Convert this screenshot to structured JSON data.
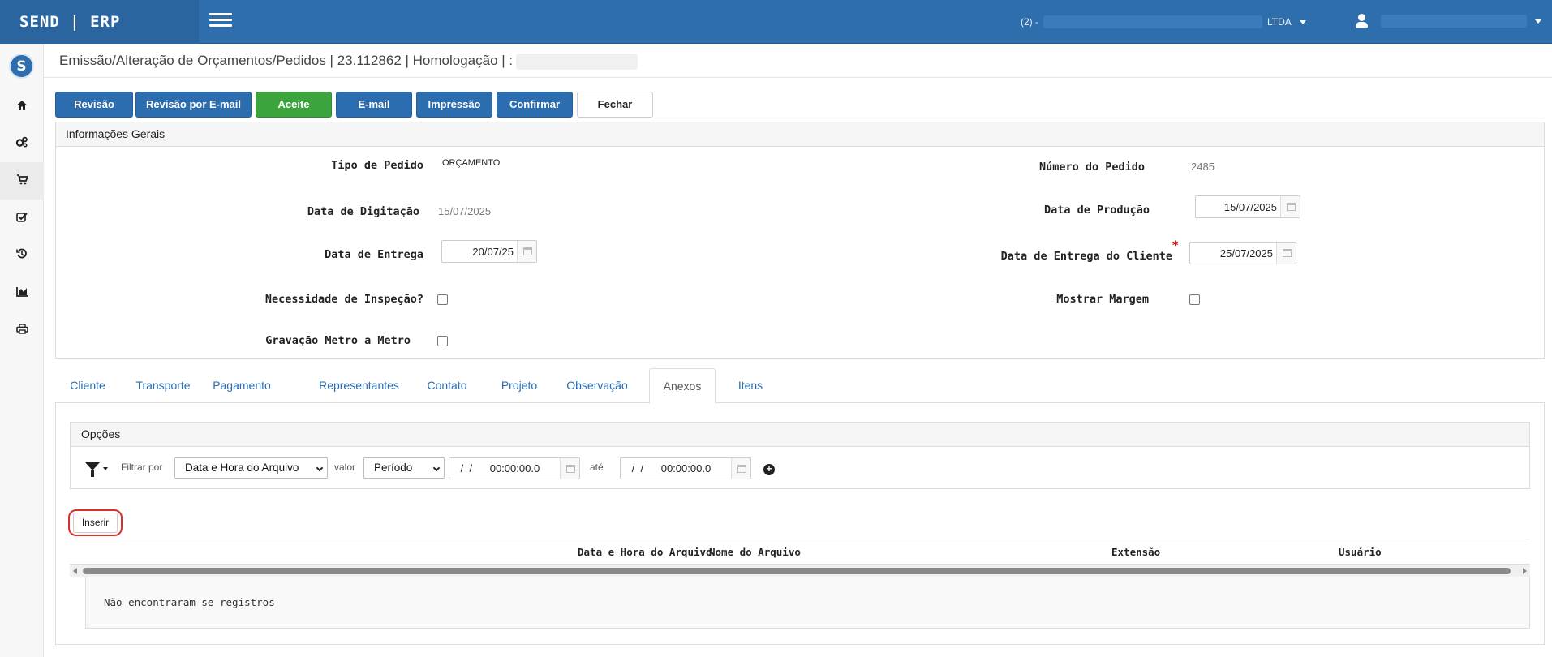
{
  "app": {
    "brand": "SEND | ERP"
  },
  "header": {
    "company_prefix": "(2) -",
    "company_suffix": "LTDA"
  },
  "breadcrumb": {
    "text": "Emissão/Alteração de Orçamentos/Pedidos | 23.112862 | Homologação | :"
  },
  "toolbar": {
    "revisao": "Revisão",
    "revisao_email": "Revisão por E-mail",
    "aceite": "Aceite",
    "email": "E-mail",
    "impressao": "Impressão",
    "confirmar": "Confirmar",
    "fechar": "Fechar"
  },
  "colors": {
    "primary": "#2c6db0",
    "success": "#3ca43c",
    "topbar": "#2e6ead",
    "highlight": "#d9302c"
  },
  "general": {
    "title": "Informações Gerais",
    "tipo_pedido_label": "Tipo de Pedido",
    "tipo_pedido_value": "ORÇAMENTO",
    "numero_pedido_label": "Número do Pedido",
    "numero_pedido_value": "2485",
    "data_digitacao_label": "Data de Digitação",
    "data_digitacao_value": "15/07/2025",
    "data_producao_label": "Data de Produção",
    "data_producao_value": "15/07/2025",
    "data_entrega_label": "Data de Entrega",
    "data_entrega_value": "20/07/25",
    "data_entrega_cliente_label": "Data de Entrega do Cliente",
    "data_entrega_cliente_value": "25/07/2025",
    "required_mark": "*",
    "inspecao_label": "Necessidade de Inspeção?",
    "margem_label": "Mostrar Margem",
    "gravacao_label": "Gravação Metro a Metro"
  },
  "tabs": {
    "cliente": "Cliente",
    "transporte": "Transporte",
    "pagamento": "Pagamento",
    "representantes": "Representantes",
    "contato": "Contato",
    "projeto": "Projeto",
    "observacao": "Observação",
    "anexos": "Anexos",
    "itens": "Itens"
  },
  "options": {
    "title": "Opções",
    "filtrar_por": "Filtrar por",
    "filter_field": "Data e Hora do Arquivo",
    "valor": "valor",
    "filter_mode": "Período",
    "date_from": " /  /      00:00:00.0",
    "ate": "até",
    "date_to": " /  /      00:00:00.0",
    "add": "+"
  },
  "grid": {
    "inserir": "Inserir",
    "col_data_hora": "Data e Hora do Arquivo",
    "col_nome": "Nome do Arquivo",
    "col_extensao": "Extensão",
    "col_usuario": "Usuário",
    "empty": "Não encontraram-se registros"
  },
  "sidebar_icons": [
    "home-icon",
    "gears-icon",
    "cart-icon",
    "check-square-icon",
    "history-icon",
    "chart-icon",
    "print-icon"
  ]
}
